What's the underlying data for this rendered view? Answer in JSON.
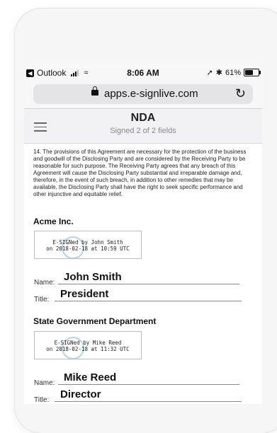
{
  "status_bar": {
    "back_app": "Outlook",
    "time": "8:06 AM",
    "battery": "61%",
    "battery_level": 0.61
  },
  "browser": {
    "url": "apps.e-signlive.com"
  },
  "header": {
    "title": "NDA",
    "subtitle": "Signed 2 of 2 fields"
  },
  "document": {
    "paragraph": "14.    The provisions of this Agreement are necessary for the protection of the business and goodwill of the Disclosing Party and are considered by the Receiving Party to be reasonable for such purpose. The Receiving Party agrees that any breach of this Agreement will cause the Disclosing Party substantial and irreparable damage and, therefore, in the event of such breach, in addition to other remedies that may be available, the Disclosing Party shall have the right to seek specific performance and other injunctive and equitable relief.",
    "parties": [
      {
        "name": "Acme Inc.",
        "esign_line1": "E-SIGNed by John Smith",
        "esign_line2": "on 2018-02-18 at 10:59 UTC",
        "name_label": "Name:",
        "name_value": "John Smith",
        "title_label": "Title:",
        "title_value": "President"
      },
      {
        "name": "State Government Department",
        "esign_line1": "E-SIGNed by Mike Reed",
        "esign_line2": "on 2018-02-18 at 11:32 UTC",
        "name_label": "Name:",
        "name_value": "Mike Reed",
        "title_label": "Title:",
        "title_value": "Director"
      }
    ]
  }
}
